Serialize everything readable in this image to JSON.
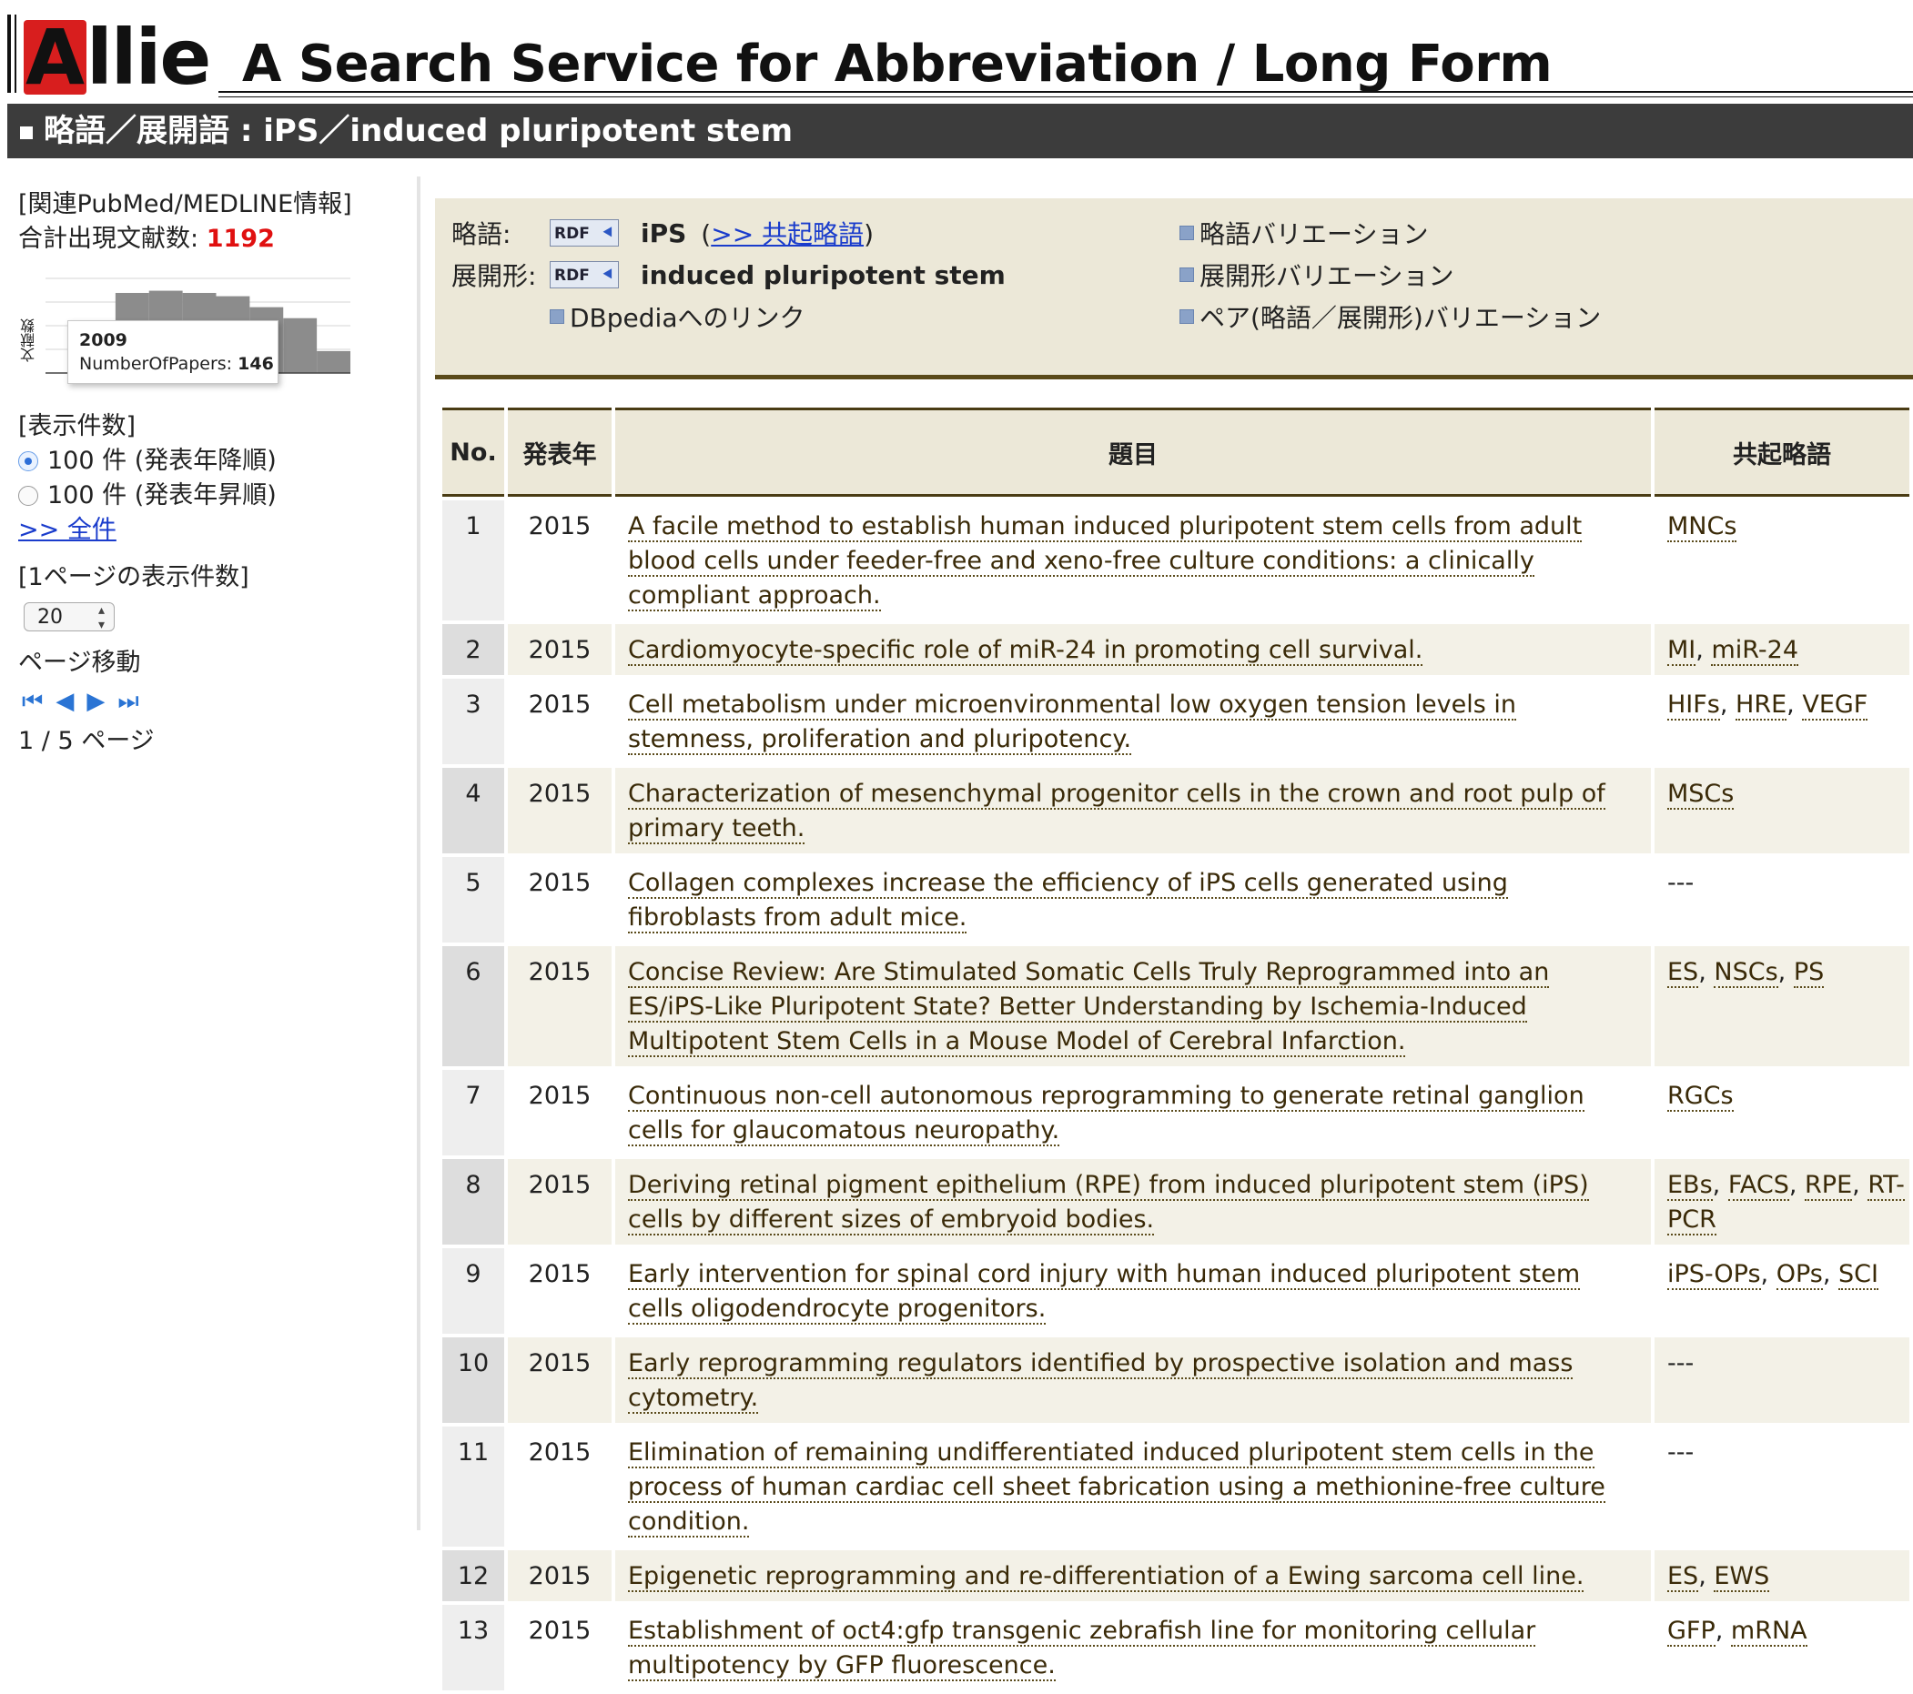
{
  "header": {
    "logo_cap": "A",
    "logo_rest": "llie",
    "site_title": "A Search Service for Abbreviation / Long Form"
  },
  "titlebar": {
    "text": "略語／展開語 : iPS／induced pluripotent stem"
  },
  "sidebar": {
    "pubmed_label": "[関連PubMed/MEDLINE情報]",
    "total_label": "合計出現文献数:",
    "total_count": "1192",
    "mini_chart": {
      "ylabel": "文献数",
      "tooltip_year": "2009",
      "tooltip_metric": "NumberOfPapers:",
      "tooltip_value": "146",
      "values": [
        90,
        146,
        150,
        146,
        140,
        120,
        100,
        40
      ]
    },
    "display_label": "[表示件数]",
    "opt_desc": "100 件 (発表年降順)",
    "opt_asc": "100 件 (発表年昇順)",
    "all_link": ">> 全件",
    "per_page_label": "[1ページの表示件数]",
    "per_page_value": "20",
    "page_nav_label": "ページ移動",
    "page_status": "1 / 5 ページ"
  },
  "info": {
    "abbr_label": "略語:",
    "abbr_value": "iPS",
    "cooccur_link": ">> 共起略語",
    "long_label": "展開形:",
    "long_value": "induced pluripotent stem",
    "dbpedia": "DBpediaへのリンク",
    "var_abbr": "略語バリエーション",
    "var_long": "展開形バリエーション",
    "var_pair": "ペア(略語／展開形)バリエーション",
    "rdf": "RDF"
  },
  "table": {
    "headers": {
      "no": "No.",
      "year": "発表年",
      "title": "題目",
      "abbr": "共起略語"
    },
    "rows": [
      {
        "no": "1",
        "year": "2015",
        "title": "A facile method to establish human induced pluripotent stem cells from adult blood cells under feeder-free and xeno-free culture conditions: a clinically compliant approach.",
        "abbrs": [
          "MNCs"
        ]
      },
      {
        "no": "2",
        "year": "2015",
        "title": "Cardiomyocyte-specific role of miR-24 in promoting cell survival.",
        "abbrs": [
          "MI",
          "miR-24"
        ]
      },
      {
        "no": "3",
        "year": "2015",
        "title": "Cell metabolism under microenvironmental low oxygen tension levels in stemness, proliferation and pluripotency.",
        "abbrs": [
          "HIFs",
          "HRE",
          "VEGF"
        ]
      },
      {
        "no": "4",
        "year": "2015",
        "title": "Characterization of mesenchymal progenitor cells in the crown and root pulp of primary teeth.",
        "abbrs": [
          "MSCs"
        ]
      },
      {
        "no": "5",
        "year": "2015",
        "title": "Collagen complexes increase the efficiency of iPS cells generated using fibroblasts from adult mice.",
        "abbrs": [],
        "none": "---"
      },
      {
        "no": "6",
        "year": "2015",
        "title": "Concise Review: Are Stimulated Somatic Cells Truly Reprogrammed into an ES/iPS-Like Pluripotent State? Better Understanding by Ischemia-Induced Multipotent Stem Cells in a Mouse Model of Cerebral Infarction.",
        "abbrs": [
          "ES",
          "NSCs",
          "PS"
        ]
      },
      {
        "no": "7",
        "year": "2015",
        "title": "Continuous non-cell autonomous reprogramming to generate retinal ganglion cells for glaucomatous neuropathy.",
        "abbrs": [
          "RGCs"
        ]
      },
      {
        "no": "8",
        "year": "2015",
        "title": "Deriving retinal pigment epithelium (RPE) from induced pluripotent stem (iPS) cells by different sizes of embryoid bodies.",
        "abbrs": [
          "EBs",
          "FACS",
          "RPE",
          "RT-PCR"
        ]
      },
      {
        "no": "9",
        "year": "2015",
        "title": "Early intervention for spinal cord injury with human induced pluripotent stem cells oligodendrocyte progenitors.",
        "abbrs": [
          "iPS-OPs",
          "OPs",
          "SCI"
        ]
      },
      {
        "no": "10",
        "year": "2015",
        "title": "Early reprogramming regulators identified by prospective isolation and mass cytometry.",
        "abbrs": [],
        "none": "---"
      },
      {
        "no": "11",
        "year": "2015",
        "title": "Elimination of remaining undifferentiated induced pluripotent stem cells in the process of human cardiac cell sheet fabrication using a methionine-free culture condition.",
        "abbrs": [],
        "none": "---"
      },
      {
        "no": "12",
        "year": "2015",
        "title": "Epigenetic reprogramming and re-differentiation of a Ewing sarcoma cell line.",
        "abbrs": [
          "ES",
          "EWS"
        ]
      },
      {
        "no": "13",
        "year": "2015",
        "title": "Establishment of oct4:gfp transgenic zebrafish line for monitoring cellular multipotency by GFP fluorescence.",
        "abbrs": [
          "GFP",
          "mRNA"
        ]
      }
    ]
  },
  "colors": {
    "accent_red": "#e01010",
    "titlebar": "#3c3c3c",
    "box_bg": "#ece8d8",
    "box_border": "#5a4a1a"
  }
}
